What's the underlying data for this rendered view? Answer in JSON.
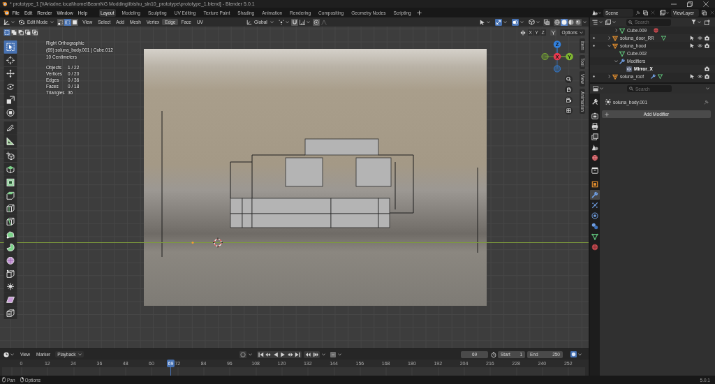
{
  "window": {
    "title": "* prototype_1 [\\\\Ariadne.local\\home\\BeamNG Modding\\ibishu_sln10_prototype\\prototype_1.blend] - Blender 5.0.1"
  },
  "menu": [
    "File",
    "Edit",
    "Render",
    "Window",
    "Help"
  ],
  "workspaces": [
    {
      "label": "Layout",
      "selected": true
    },
    {
      "label": "Modeling",
      "selected": false
    },
    {
      "label": "Sculpting",
      "selected": false
    },
    {
      "label": "UV Editing",
      "selected": false
    },
    {
      "label": "Texture Paint",
      "selected": false
    },
    {
      "label": "Shading",
      "selected": false
    },
    {
      "label": "Animation",
      "selected": false
    },
    {
      "label": "Rendering",
      "selected": false
    },
    {
      "label": "Compositing",
      "selected": false
    },
    {
      "label": "Geometry Nodes",
      "selected": false
    },
    {
      "label": "Scripting",
      "selected": false
    }
  ],
  "scene": {
    "name": "Scene"
  },
  "view_layer": {
    "name": "ViewLayer"
  },
  "viewport_header": {
    "mode": "Edit Mode",
    "select_modes": [
      {
        "kind": "vertex",
        "selected": false
      },
      {
        "kind": "edge",
        "selected": true
      },
      {
        "kind": "face",
        "selected": false
      }
    ],
    "menus": [
      {
        "label": "View",
        "hovered": false
      },
      {
        "label": "Select",
        "hovered": false
      },
      {
        "label": "Add",
        "hovered": false
      },
      {
        "label": "Mesh",
        "hovered": false
      },
      {
        "label": "Vertex",
        "hovered": false
      },
      {
        "label": "Edge",
        "hovered": true
      },
      {
        "label": "Face",
        "hovered": false
      },
      {
        "label": "UV",
        "hovered": false
      }
    ],
    "orientation": "Global",
    "snap": {
      "on": false
    },
    "proportional": {
      "on": false
    },
    "toggles": [
      {
        "kind": "gizmos",
        "on": true
      },
      {
        "kind": "overlays",
        "on": true
      },
      {
        "kind": "xray",
        "on": false
      }
    ],
    "shading": [
      {
        "kind": "wireframe",
        "selected": false
      },
      {
        "kind": "solid",
        "selected": true
      },
      {
        "kind": "material",
        "selected": false
      },
      {
        "kind": "rendered",
        "selected": false
      }
    ]
  },
  "toolbar": {
    "select_operations": [
      {
        "kind": "set",
        "selected": true
      },
      {
        "kind": "extend",
        "selected": false
      },
      {
        "kind": "subtract",
        "selected": false
      },
      {
        "kind": "invert",
        "selected": false
      },
      {
        "kind": "intersect",
        "selected": false
      }
    ],
    "groups": [
      {
        "tools": [
          {
            "kind": "select_box",
            "selected": true
          },
          {
            "kind": "cursor",
            "selected": false
          }
        ]
      },
      {
        "tools": [
          {
            "kind": "move",
            "selected": false
          },
          {
            "kind": "rotate",
            "selected": false
          },
          {
            "kind": "scale",
            "selected": false
          },
          {
            "kind": "transform",
            "selected": false
          }
        ]
      },
      {
        "tools": [
          {
            "kind": "annotate",
            "selected": false
          },
          {
            "kind": "measure",
            "selected": false
          }
        ]
      },
      {
        "tools": [
          {
            "kind": "add_cube",
            "selected": false
          }
        ]
      },
      {
        "tools": [
          {
            "kind": "extrude",
            "selected": false
          },
          {
            "kind": "inset",
            "selected": false
          },
          {
            "kind": "bevel",
            "selected": false
          },
          {
            "kind": "loop_cut",
            "selected": false
          },
          {
            "kind": "knife",
            "selected": false
          },
          {
            "kind": "poly_build",
            "selected": false
          },
          {
            "kind": "spin",
            "selected": false
          },
          {
            "kind": "smooth",
            "selected": false
          },
          {
            "kind": "edge_slide",
            "selected": false
          },
          {
            "kind": "shrink_fatten",
            "selected": false
          },
          {
            "kind": "shear",
            "selected": false
          },
          {
            "kind": "rip",
            "selected": false
          }
        ]
      }
    ]
  },
  "viewport_info": {
    "view": "Right Orthographic",
    "object": "(69) soluna_body.001 | Cube.012",
    "units": "10 Centimeters",
    "stats": [
      {
        "label": "Objects",
        "value": "1 / 22"
      },
      {
        "label": "Vertices",
        "value": "0 / 20"
      },
      {
        "label": "Edges",
        "value": "0 / 36"
      },
      {
        "label": "Faces",
        "value": "0 / 18"
      },
      {
        "label": "Triangles",
        "value": "36"
      }
    ]
  },
  "mirror_axes": [
    {
      "label": "X",
      "on": false
    },
    {
      "label": "Y",
      "on": false
    },
    {
      "label": "Z",
      "on": false
    }
  ],
  "options": "Options",
  "gizmo_axes": [
    {
      "label": "Z",
      "kind": "up",
      "color": "#3180dd"
    },
    {
      "label": "X",
      "kind": "center",
      "color": "#e8394f"
    },
    {
      "label": "Y",
      "kind": "right",
      "color": "#7fb532"
    }
  ],
  "sidebar_tabs": [
    {
      "label": "Item",
      "selected": false
    },
    {
      "label": "Tool",
      "selected": false
    },
    {
      "label": "View",
      "selected": false
    },
    {
      "label": "Animation",
      "selected": false
    }
  ],
  "outliner": {
    "search": {
      "placeholder": "Search"
    },
    "rows": [
      {
        "children": [
          {
            "name": "Cube.009",
            "kind": "mesh",
            "expanded": false,
            "inline": [
              {
                "kind": "material"
              }
            ]
          }
        ]
      },
      {
        "name": "soluna_door_RR",
        "kind": "object",
        "expanded": false,
        "inline": [
          {
            "kind": "mesh"
          }
        ],
        "selectable": true,
        "visible": true,
        "renderable": true
      },
      {
        "name": "soluna_hood",
        "kind": "object",
        "expanded": true,
        "selectable": true,
        "visible": true,
        "renderable": true,
        "children": [
          {
            "name": "Cube.002",
            "kind": "mesh"
          },
          {
            "name": "Modifiers",
            "kind": "modifiers",
            "expanded": true,
            "children": [
              {
                "name": "Mirror_X",
                "kind": "modifier",
                "renderable": true
              }
            ]
          }
        ]
      },
      {
        "name": "soluna_roof",
        "kind": "object",
        "expanded": false,
        "inline": [
          {
            "kind": "modifiers"
          },
          {
            "kind": "mesh"
          }
        ],
        "selectable": true,
        "visible": true,
        "renderable": true
      }
    ]
  },
  "properties": {
    "search": {
      "placeholder": "Search"
    },
    "tab_groups": [
      {
        "tabs": [
          {
            "kind": "tool",
            "selected": false
          }
        ]
      },
      {
        "tabs": [
          {
            "kind": "render",
            "selected": false
          },
          {
            "kind": "output",
            "selected": false
          },
          {
            "kind": "view_layer",
            "selected": false
          },
          {
            "kind": "scene",
            "selected": false
          },
          {
            "kind": "world",
            "selected": false
          }
        ]
      },
      {
        "tabs": [
          {
            "kind": "collection",
            "selected": false
          }
        ]
      },
      {
        "tabs": [
          {
            "kind": "object",
            "selected": false
          },
          {
            "kind": "modifiers",
            "selected": true
          },
          {
            "kind": "particles",
            "selected": false
          },
          {
            "kind": "physics",
            "selected": false
          },
          {
            "kind": "constraints",
            "selected": false
          },
          {
            "kind": "data",
            "selected": false
          },
          {
            "kind": "material",
            "selected": false
          }
        ]
      }
    ],
    "object": "soluna_body.001",
    "add_modifier": "Add Modifier"
  },
  "timeline": {
    "menus": [
      {
        "label": "View",
        "kind": "menu"
      },
      {
        "label": "Marker",
        "kind": "menu"
      },
      {
        "label": "Playback",
        "kind": "dropdown"
      }
    ],
    "current_frame": "69",
    "start": {
      "label": "Start",
      "value": "1"
    },
    "end": {
      "label": "End",
      "value": "250"
    },
    "ruler": [
      "0",
      "12",
      "24",
      "36",
      "48",
      "60",
      "72",
      "84",
      "96",
      "108",
      "120",
      "132",
      "144",
      "156",
      "168",
      "180",
      "192",
      "204",
      "216",
      "228",
      "240",
      "252"
    ],
    "playhead": {
      "label": "69"
    }
  },
  "status_bar": {
    "hints": [
      {
        "kind": "middle_mouse",
        "label": "Pan"
      },
      {
        "kind": "right_mouse",
        "label": "Options"
      }
    ],
    "version": "5.0.1"
  }
}
